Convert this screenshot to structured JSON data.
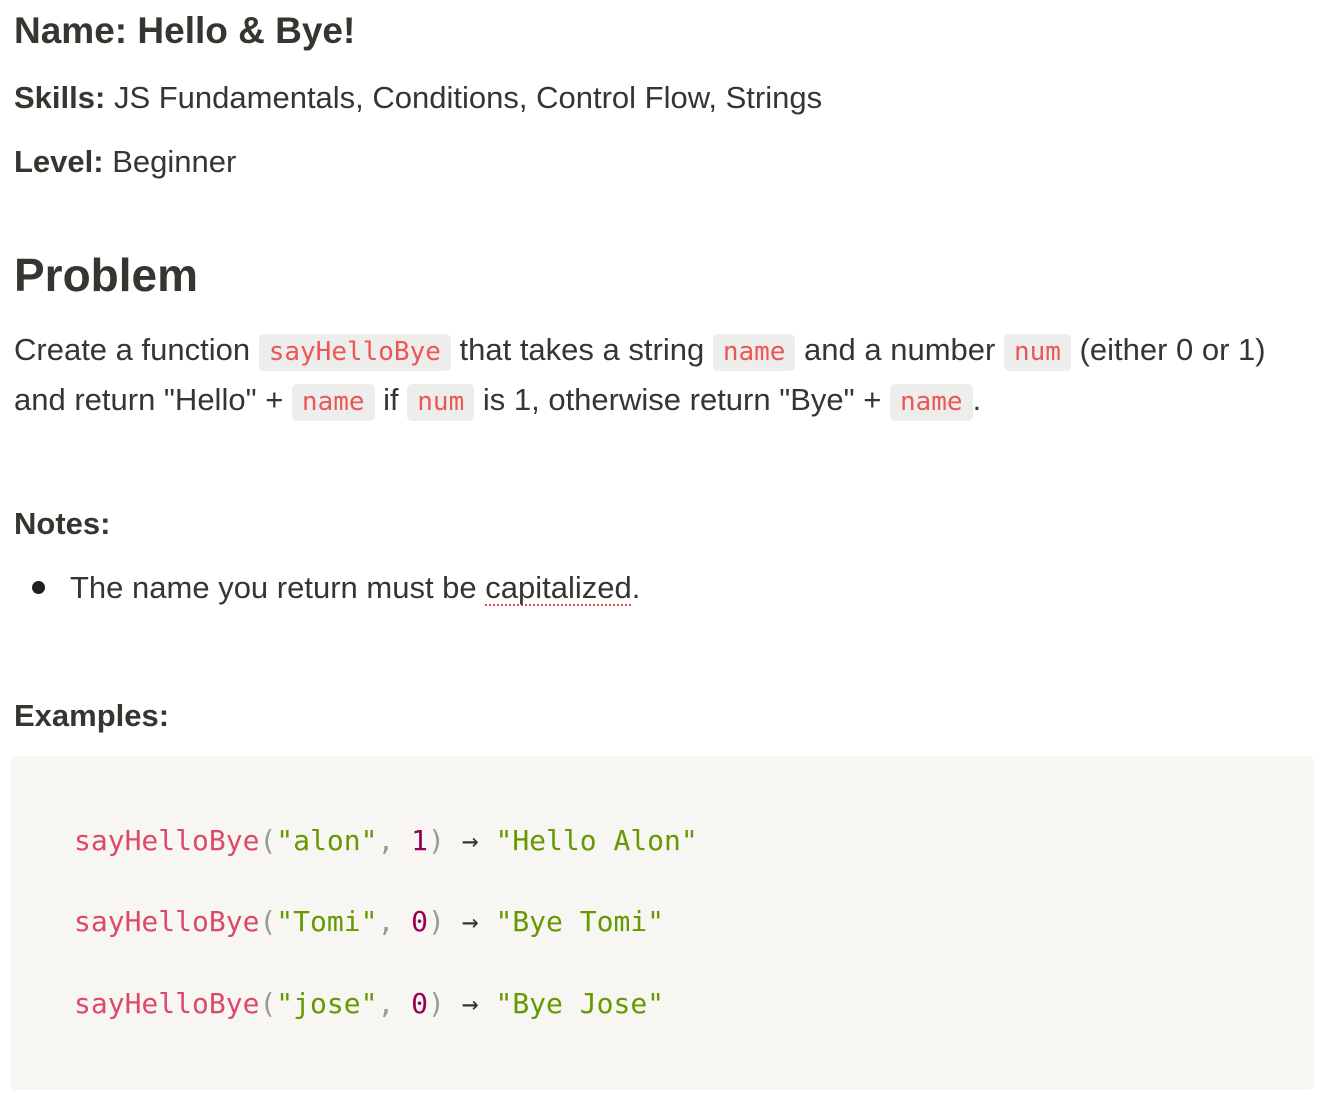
{
  "header": {
    "name_label": "Name:",
    "name_value": "Hello & Bye!",
    "skills_label": "Skills:",
    "skills_value": "JS Fundamentals, Conditions, Control Flow, Strings",
    "level_label": "Level:",
    "level_value": "Beginner"
  },
  "problem": {
    "heading": "Problem",
    "t1": "Create a function ",
    "c1": "sayHelloBye",
    "t2": " that takes a string ",
    "c2": "name",
    "t3": " and a number ",
    "c3": "num",
    "t4": " (either 0 or 1) and return \"Hello\" + ",
    "c4": "name",
    "t5": " if ",
    "c5": "num",
    "t6": " is 1, otherwise return \"Bye\" + ",
    "c6": "name",
    "t7": "."
  },
  "notes": {
    "heading": "Notes:",
    "item_before": "The name you return must be ",
    "item_flagged": "capitalized",
    "item_after": "."
  },
  "examples": {
    "heading": "Examples:",
    "lines": [
      {
        "fn": "sayHelloBye",
        "open": "(",
        "arg": "\"alon\"",
        "comma": ", ",
        "num": "1",
        "close": ")",
        "arrow": " → ",
        "result": "\"Hello Alon\""
      },
      {
        "fn": "sayHelloBye",
        "open": "(",
        "arg": "\"Tomi\"",
        "comma": ", ",
        "num": "0",
        "close": ")",
        "arrow": " → ",
        "result": "\"Bye Tomi\""
      },
      {
        "fn": "sayHelloBye",
        "open": "(",
        "arg": "\"jose\"",
        "comma": ", ",
        "num": "0",
        "close": ")",
        "arrow": " → ",
        "result": "\"Bye Jose\""
      }
    ]
  },
  "colors": {
    "text": "#37352f",
    "inline_code": "#eb5757",
    "inline_code_bg": "#ededeb",
    "code_block_bg": "#f7f6f3",
    "fn": "#dd4a68",
    "string": "#669900",
    "number": "#990055"
  }
}
